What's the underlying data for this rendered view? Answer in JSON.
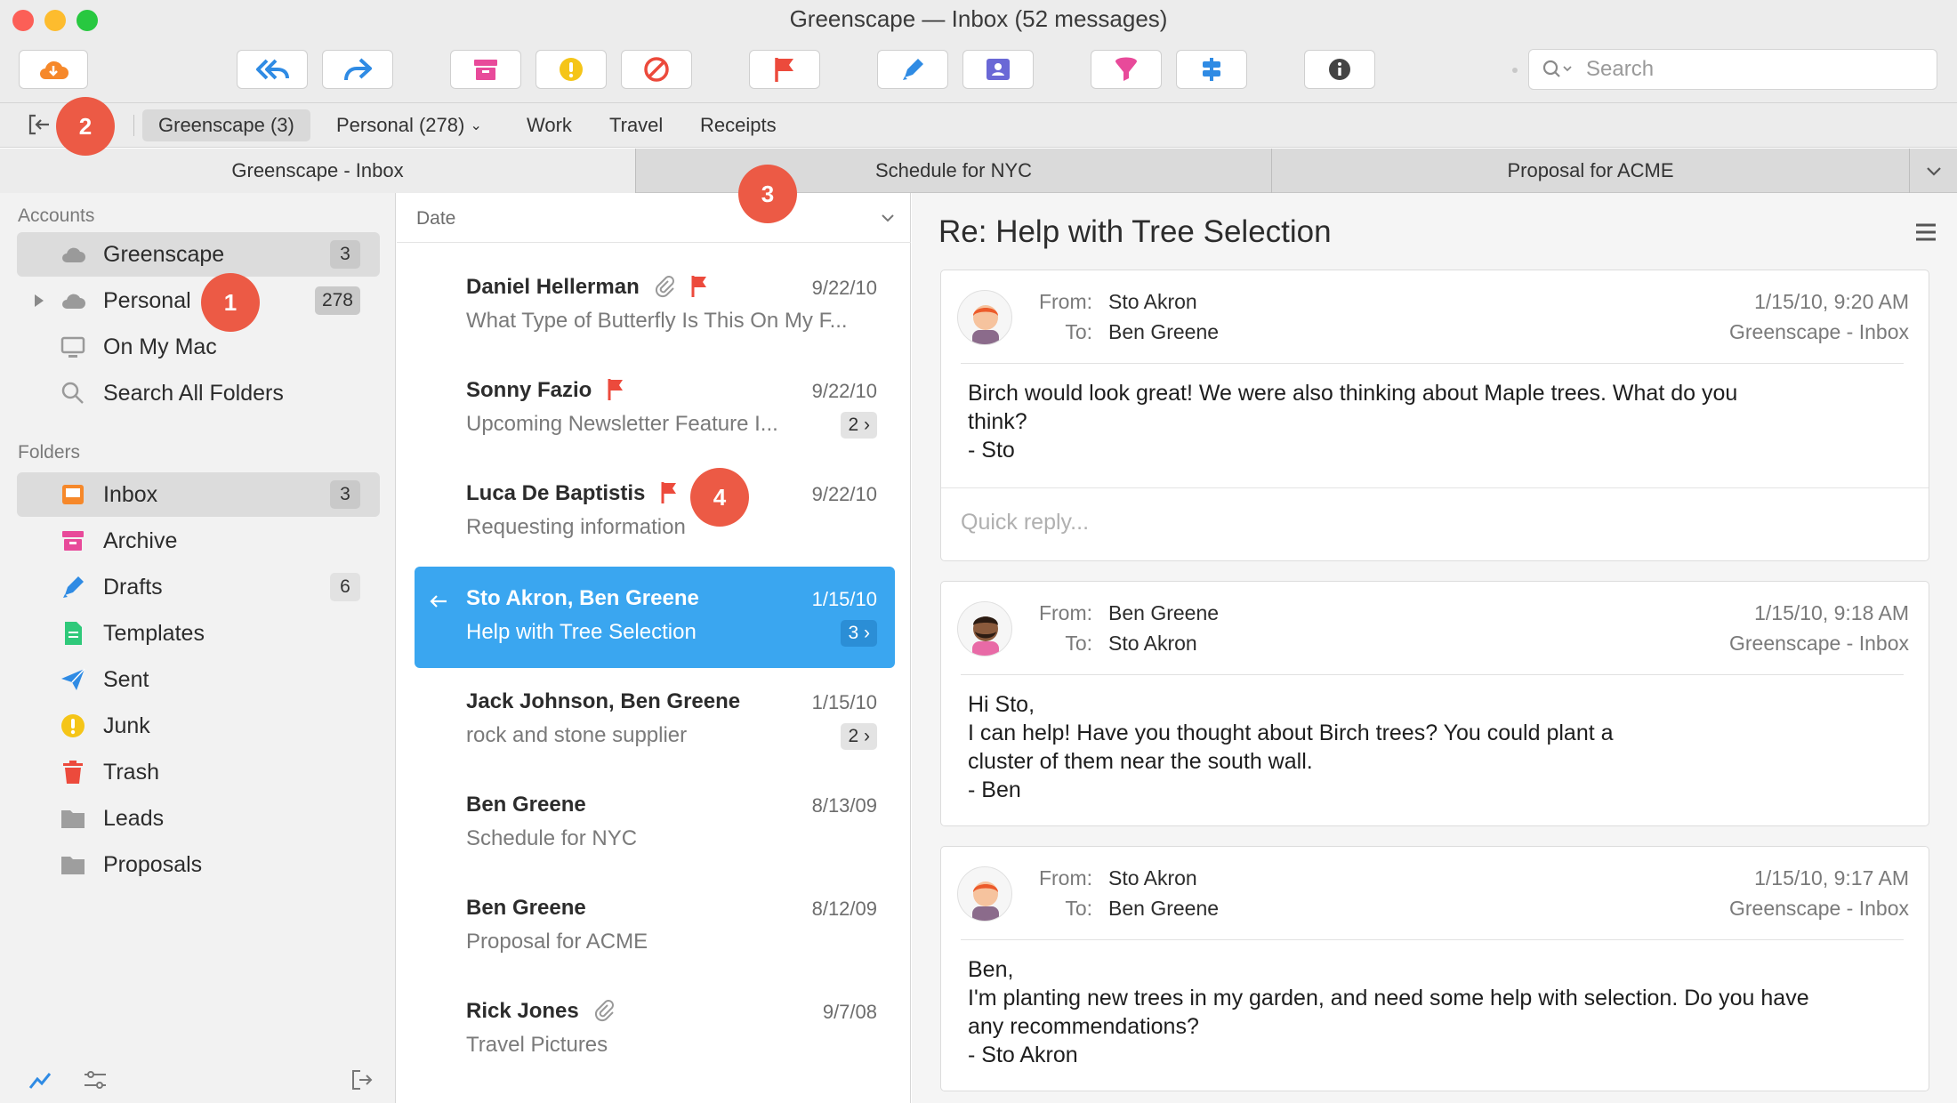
{
  "window": {
    "title": "Greenscape — Inbox (52 messages)"
  },
  "toolbar": {
    "search_placeholder": "Search"
  },
  "favorites": [
    "Greenscape (3)",
    "Personal (278)",
    "Work",
    "Travel",
    "Receipts"
  ],
  "tabs": [
    "Greenscape - Inbox",
    "Schedule for NYC",
    "Proposal for ACME"
  ],
  "sidebar": {
    "accounts_header": "Accounts",
    "accounts": [
      {
        "label": "Greenscape",
        "count": "3"
      },
      {
        "label": "Personal",
        "count": "278"
      },
      {
        "label": "On My Mac"
      },
      {
        "label": "Search All Folders"
      }
    ],
    "folders_header": "Folders",
    "folders": [
      {
        "label": "Inbox",
        "count": "3",
        "icon": "inbox-icon",
        "color": "#f6882a"
      },
      {
        "label": "Archive",
        "icon": "archive-icon",
        "color": "#e84a9a"
      },
      {
        "label": "Drafts",
        "count": "6",
        "icon": "pencil-icon",
        "color": "#2f8be4"
      },
      {
        "label": "Templates",
        "icon": "document-icon",
        "color": "#2fc97a"
      },
      {
        "label": "Sent",
        "icon": "paper-plane-icon",
        "color": "#2f8be4"
      },
      {
        "label": "Junk",
        "icon": "warning-icon",
        "color": "#f5c518"
      },
      {
        "label": "Trash",
        "icon": "trash-icon",
        "color": "#ec4a3c"
      },
      {
        "label": "Leads",
        "icon": "folder-icon",
        "color": "#9e9e9e"
      },
      {
        "label": "Proposals",
        "icon": "folder-icon",
        "color": "#9e9e9e"
      }
    ]
  },
  "list": {
    "sort_label": "Date",
    "messages": [
      {
        "from": "Daniel Hellerman",
        "subject": "What Type of Butterfly Is This On My F...",
        "date": "9/22/10"
      },
      {
        "from": "Sonny Fazio",
        "subject": "Upcoming Newsletter Feature I...",
        "date": "9/22/10",
        "thread": "2 ›"
      },
      {
        "from": "Luca De Baptistis",
        "subject": "Requesting information",
        "date": "9/22/10"
      },
      {
        "from": "Sto Akron, Ben Greene",
        "subject": "Help with Tree Selection",
        "date": "1/15/10",
        "thread": "3 ›"
      },
      {
        "from": "Jack Johnson, Ben Greene",
        "subject": "rock and stone supplier",
        "date": "1/15/10",
        "thread": "2 ›"
      },
      {
        "from": "Ben Greene",
        "subject": "Schedule for NYC",
        "date": "8/13/09"
      },
      {
        "from": "Ben Greene",
        "subject": "Proposal for ACME",
        "date": "8/12/09"
      },
      {
        "from": "Rick Jones",
        "subject": "Travel Pictures",
        "date": "9/7/08"
      }
    ]
  },
  "reader": {
    "title": "Re: Help with Tree Selection",
    "from_key": "From:",
    "to_key": "To:",
    "quick_reply_placeholder": "Quick reply...",
    "messages": [
      {
        "from": "Sto Akron",
        "to": "Ben Greene",
        "date": "1/15/10, 9:20 AM",
        "folder": "Greenscape - Inbox",
        "body": "Birch would look great!  We were also thinking about Maple trees.  What do you\nthink?\n- Sto"
      },
      {
        "from": "Ben Greene",
        "to": "Sto Akron",
        "date": "1/15/10, 9:18 AM",
        "folder": "Greenscape - Inbox",
        "body": "Hi Sto,\nI can help!  Have you thought about Birch trees?  You could plant a\ncluster of them near the south wall.\n- Ben"
      },
      {
        "from": "Sto Akron",
        "to": "Ben Greene",
        "date": "1/15/10, 9:17 AM",
        "folder": "Greenscape - Inbox",
        "body": "Ben,\nI'm planting new trees in my garden, and need some help with selection.  Do you have\nany recommendations?\n- Sto Akron"
      }
    ]
  },
  "callouts": [
    "1",
    "2",
    "3",
    "4"
  ],
  "colors": {
    "accent": "#3aa6f0",
    "flag": "#ec4a3c",
    "callout": "#ec5a45"
  }
}
